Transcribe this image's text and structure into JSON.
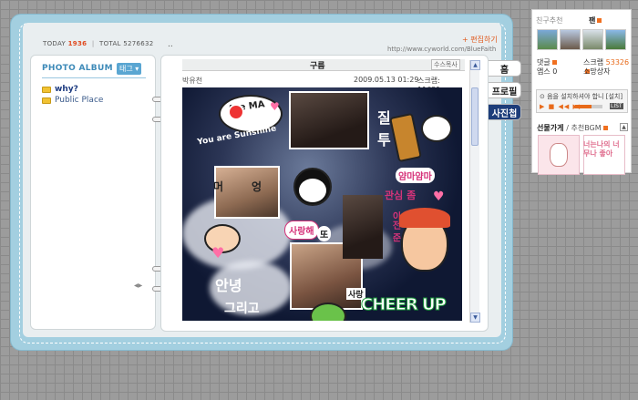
{
  "counter": {
    "today_label": "TODAY",
    "today_value": "1936",
    "total_label": "TOTAL",
    "total_value": "5276632"
  },
  "header_dots": "..",
  "edit_link": "+ 편집하기",
  "url": "http://www.cyworld.com/BlueFaith",
  "album": {
    "title": "PHOTO ALBUM",
    "tag_button": "태그 ▾",
    "folders": [
      {
        "label": "why?"
      },
      {
        "label": "Public Place"
      }
    ]
  },
  "post": {
    "title": "구름",
    "scrap_button": "수스목사",
    "author": "박유천",
    "date": "2009.05.13 01:29",
    "scrap_label": "스크랩",
    "scrap_count": "11621"
  },
  "collage_text": {
    "are_ma": "Are MA",
    "you_sunshine": "You are Sunshine",
    "jil": "질",
    "tu": "투",
    "meong1": "머",
    "meong2": "엉",
    "yamayama": "얌마얌마",
    "gwansim": "관심 좀",
    "saranghae": "사랑해",
    "tto": "또",
    "annyeong": "안녕",
    "geurigo": "그리고",
    "cheer": "CHEER UP",
    "love": "사랑",
    "ijeon": "이전 준"
  },
  "side_tabs": [
    "홈",
    "프로필",
    "사진첩"
  ],
  "panel": {
    "friends_label": "친구추천",
    "fan_label": "팬",
    "comments_label": "댓글",
    "apps_label": "앱스",
    "apps_value": "0",
    "scrap_label": "스크랩",
    "scrap_value": "53326",
    "shop_label": "소망상자",
    "player_msg": "⊙ 음을 설치하셔야 합니 [설치]",
    "list_label": "LIST",
    "gift_title": "선물가게",
    "gift_sub": "/ 추천BGM",
    "gift_text": "너는나의 너무나 좋아"
  },
  "colors": {
    "accent": "#e04a1f",
    "frame": "#a3cfe0",
    "album_title": "#3d8ab8"
  }
}
